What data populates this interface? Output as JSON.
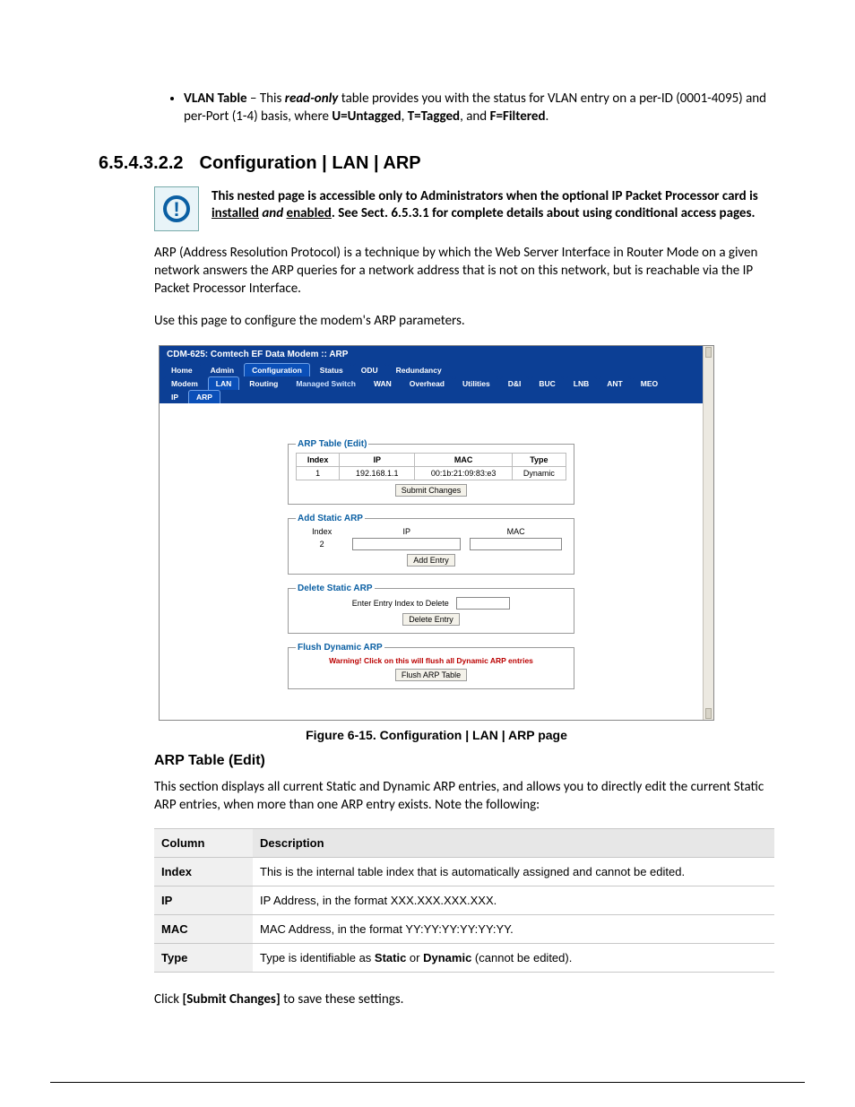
{
  "bullet": {
    "title": "VLAN Table",
    "pre": " – This ",
    "ro": "read-only",
    "post1": " table provides you with the status for VLAN entry on a per-ID (0001-4095) and per-Port (1-4) basis, where ",
    "u": "U=Untagged",
    "c1": ", ",
    "t": "T=Tagged",
    "c2": ", and ",
    "f": "F=Filtered",
    "dot": "."
  },
  "section": {
    "num": "6.5.4.3.2.2",
    "title": "Configuration | LAN | ARP"
  },
  "note": {
    "p1": "This nested page is accessible only to Administrators when the optional IP Packet Processor card is ",
    "u1": "installed",
    "mid": " and ",
    "u2": "enabled",
    "p2": ". See Sect. 6.5.3.1 for complete details about using conditional access pages."
  },
  "para1": "ARP (Address Resolution Protocol) is a technique by which the Web Server Interface in Router Mode on a given network answers the ARP queries for a network address that is not on this network, but is reachable via the IP Packet Processor Interface.",
  "para2": "Use this page to configure the modem's ARP parameters.",
  "win": {
    "title": "CDM-625: Comtech EF Data Modem :: ARP",
    "tabs1": [
      "Home",
      "Admin",
      "Configuration",
      "Status",
      "ODU",
      "Redundancy"
    ],
    "tabs1_active": 2,
    "tabs2": [
      "Modem",
      "LAN",
      "Routing",
      "Managed Switch",
      "WAN",
      "Overhead",
      "Utilities",
      "D&I",
      "BUC",
      "LNB",
      "ANT",
      "MEO"
    ],
    "tabs2_active": 1,
    "tabs3": [
      "IP",
      "ARP"
    ],
    "tabs3_active": 1,
    "arp_table": {
      "legend": "ARP Table (Edit)",
      "headers": [
        "Index",
        "IP",
        "MAC",
        "Type"
      ],
      "rows": [
        [
          "1",
          "192.168.1.1",
          "00:1b:21:09:83:e3",
          "Dynamic"
        ]
      ],
      "submit": "Submit Changes"
    },
    "add": {
      "legend": "Add Static ARP",
      "lbls": [
        "Index",
        "IP",
        "MAC"
      ],
      "index": "2",
      "btn": "Add Entry"
    },
    "del": {
      "legend": "Delete Static ARP",
      "lbl": "Enter Entry Index to Delete",
      "btn": "Delete Entry"
    },
    "flush": {
      "legend": "Flush Dynamic ARP",
      "warn": "Warning! Click on this will flush all Dynamic ARP entries",
      "btn": "Flush ARP Table"
    }
  },
  "figcaption": "Figure 6-15. Configuration | LAN | ARP page",
  "subheading": "ARP Table (Edit)",
  "para3": "This section displays all current Static and Dynamic ARP entries, and allows you to directly edit the current Static ARP entries, when more than one ARP entry exists. Note the following:",
  "desc": {
    "headers": [
      "Column",
      "Description"
    ],
    "rows": [
      {
        "c": "Index",
        "d": "This is the internal table index that is automatically assigned and cannot be edited."
      },
      {
        "c": "IP",
        "d": "IP Address, in the format XXX.XXX.XXX.XXX."
      },
      {
        "c": "MAC",
        "d": "MAC Address, in the format YY:YY:YY:YY:YY:YY."
      },
      {
        "c": "Type",
        "d_pre": "Type is identifiable as ",
        "s": "Static",
        "or": " or ",
        "dy": "Dynamic",
        "post": " (cannot be edited)."
      }
    ]
  },
  "click": {
    "pre": "Click ",
    "btn": "[Submit Changes]",
    "post": " to save these settings."
  }
}
